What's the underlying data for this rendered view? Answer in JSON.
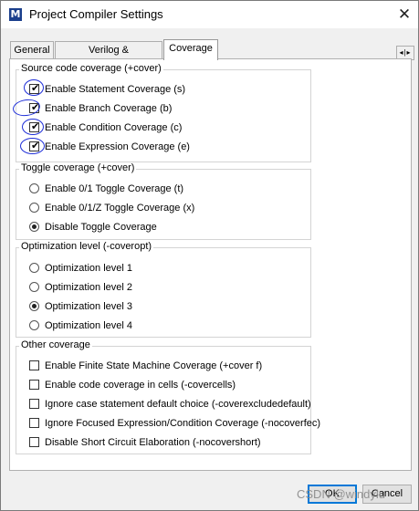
{
  "window": {
    "icon_letter": "M",
    "title": "Project Compiler Settings",
    "close": "✕"
  },
  "tabs": [
    {
      "label": "General"
    },
    {
      "label": "Verilog & SystemVerilog"
    },
    {
      "label": "Coverage",
      "active": true
    }
  ],
  "tab_scroll": "◂|▸",
  "source_coverage": {
    "title": "Source code coverage (+cover)",
    "items": [
      {
        "label": "Enable Statement Coverage (s)",
        "checked": true
      },
      {
        "label": "Enable Branch Coverage (b)",
        "checked": true
      },
      {
        "label": "Enable Condition Coverage (c)",
        "checked": true
      },
      {
        "label": "Enable Expression Coverage (e)",
        "checked": true
      }
    ]
  },
  "toggle_coverage": {
    "title": "Toggle coverage (+cover)",
    "items": [
      {
        "label": "Enable 0/1 Toggle Coverage (t)",
        "selected": false
      },
      {
        "label": "Enable 0/1/Z Toggle Coverage (x)",
        "selected": false
      },
      {
        "label": "Disable Toggle Coverage",
        "selected": true
      }
    ]
  },
  "optimization": {
    "title": "Optimization level (-coveropt)",
    "items": [
      {
        "label": "Optimization level 1",
        "selected": false
      },
      {
        "label": "Optimization level 2",
        "selected": false
      },
      {
        "label": "Optimization level 3",
        "selected": true
      },
      {
        "label": "Optimization level 4",
        "selected": false
      }
    ]
  },
  "other_coverage": {
    "title": "Other coverage",
    "items": [
      {
        "label": "Enable Finite State Machine Coverage (+cover f)",
        "checked": false
      },
      {
        "label": "Enable code coverage in cells (-covercells)",
        "checked": false
      },
      {
        "label": "Ignore case statement default choice (-coverexcludedefault)",
        "checked": false
      },
      {
        "label": "Ignore Focused Expression/Condition Coverage (-nocoverfec)",
        "checked": false
      },
      {
        "label": "Disable Short Circuit Elaboration (-nocovershort)",
        "checked": false
      }
    ]
  },
  "buttons": {
    "ok": "OK",
    "cancel": "Cancel"
  },
  "watermark": "CSDN @windylu"
}
